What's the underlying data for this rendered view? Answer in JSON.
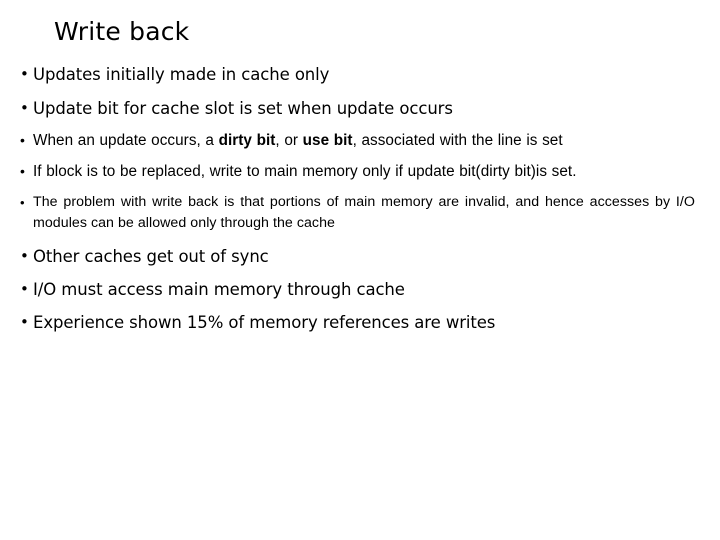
{
  "slide": {
    "title": "Write back",
    "bullet_glyph": "•",
    "background_color": "#ffffff",
    "text_color": "#000000",
    "bullets": [
      {
        "id": "updates-initially",
        "text": "Updates initially made in cache only"
      },
      {
        "id": "update-bit-set",
        "text": "Update bit for cache slot is set when update occurs"
      },
      {
        "id": "dirty-bit",
        "text_before": "When an update occurs, a ",
        "bold_1": "dirty bit",
        "text_middle": ", or ",
        "bold_2": "use bit",
        "text_after": ", associated with the line is set"
      },
      {
        "id": "replace-block",
        "text": "If block is to be replaced, write to main memory only if update bit(dirty bit)is set."
      },
      {
        "id": "write-back-problem",
        "text": "The problem with write back is that portions of main memory are invalid, and hence accesses by I/O modules can be allowed only through the cache"
      },
      {
        "id": "caches-out-of-sync",
        "text": "Other caches get out of sync"
      },
      {
        "id": "io-through-cache",
        "text": "I/O must access main memory through cache"
      },
      {
        "id": "writes-percentage",
        "text": "Experience shown 15% of memory references are writes"
      }
    ]
  }
}
